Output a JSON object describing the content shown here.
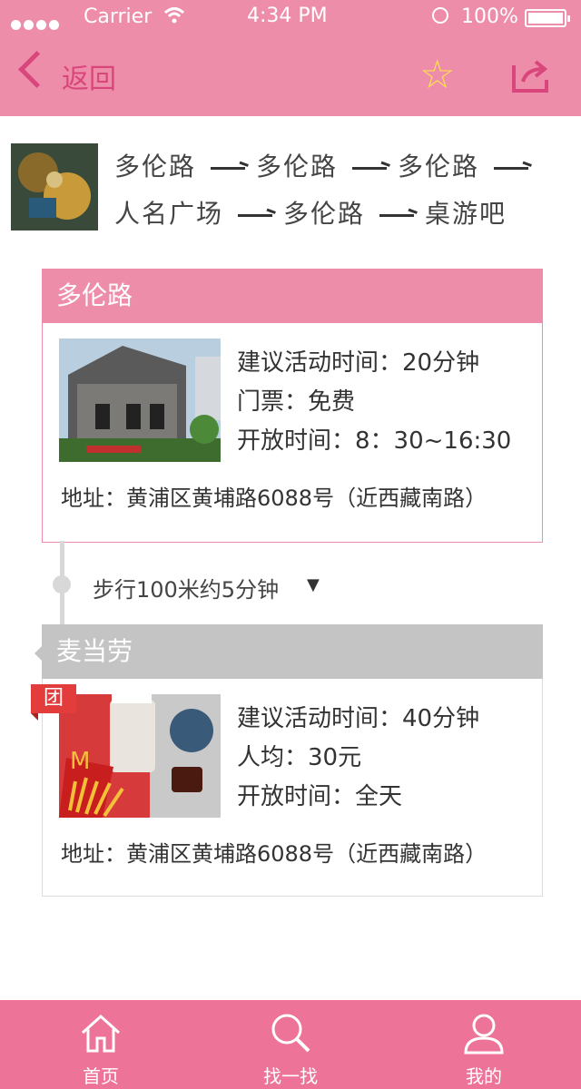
{
  "status_bar": {
    "carrier": "Carrier",
    "time": "4:34 PM",
    "battery": "100%"
  },
  "nav": {
    "back_label": "返回",
    "favorite_icon": "star-icon",
    "share_icon": "share-icon"
  },
  "route": {
    "line1": [
      "多伦路",
      "多伦路",
      "多伦路"
    ],
    "line2": [
      "人名广场",
      "多伦路",
      "桌游吧"
    ]
  },
  "stops": [
    {
      "name": "多伦路",
      "suggested_time": "建议活动时间：20分钟",
      "ticket": "门票：免费",
      "open_hours": "开放时间：8：30~16:30",
      "address": "地址：黄浦区黄埔路6088号（近西藏南路）"
    },
    {
      "name": "麦当劳",
      "badge": "团",
      "suggested_time": "建议活动时间：40分钟",
      "per_person": "人均：30元",
      "open_hours": "开放时间：全天",
      "address": "地址：黄浦区黄埔路6088号（近西藏南路）"
    }
  ],
  "transit": {
    "walk": "步行100米约5分钟"
  },
  "tabbar": {
    "items": [
      {
        "label": "首页",
        "icon": "home-icon"
      },
      {
        "label": "找一找",
        "icon": "search-icon"
      },
      {
        "label": "我的",
        "icon": "user-icon"
      }
    ]
  },
  "colors": {
    "accent": "#ee8daa",
    "tabbar": "#ee7399",
    "back": "#d9467c",
    "badge": "#e23c3c"
  }
}
